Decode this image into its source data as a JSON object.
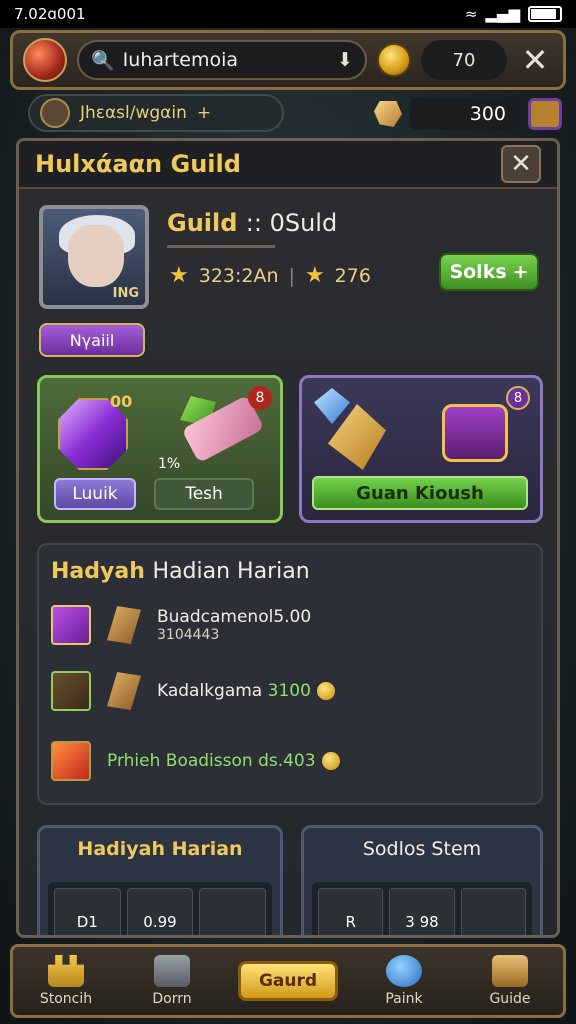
{
  "status": {
    "time": "7.02ɑ001"
  },
  "topbar": {
    "search_value": "Iuhartemoia",
    "coins": "70"
  },
  "subbar": {
    "label": "Jhεαsl/wgαin"
  },
  "resource": {
    "value": "300"
  },
  "panel": {
    "title": "Hulxάaαn Guild"
  },
  "guild": {
    "name": "Guild",
    "name_sub": ":: 0Suld",
    "level_tag": "ING",
    "stat1": "323:2An",
    "stat2": "276",
    "role_badge": "Nγaiil",
    "action_button": "Solks"
  },
  "cards": {
    "left": {
      "count": "00",
      "pct": "1%",
      "badge": "8",
      "button1": "Luuik",
      "button2": "Tesh"
    },
    "right": {
      "badge": "8",
      "button": "Guan Kioush"
    }
  },
  "daily": {
    "title_main": "Hadyah",
    "title_rest": "Hadian Harian",
    "items": [
      {
        "text": "Buadcamenol5.00",
        "sub": "3104443"
      },
      {
        "text": "Kadalkgama",
        "value": "3100"
      },
      {
        "text": "Prhieh Boadisson ds.403"
      }
    ]
  },
  "bottom_cards": {
    "left": {
      "title": "Hadiyah Harian",
      "slot_label": "D1",
      "slot_value": "0.99"
    },
    "right": {
      "title": "Sodlos Stem",
      "slot_label": "R",
      "slot_value": "3 98"
    }
  },
  "nav": {
    "items": [
      "Stoncih",
      "Dorrn",
      "Paink",
      "Guide"
    ],
    "center": "Gaurd"
  }
}
